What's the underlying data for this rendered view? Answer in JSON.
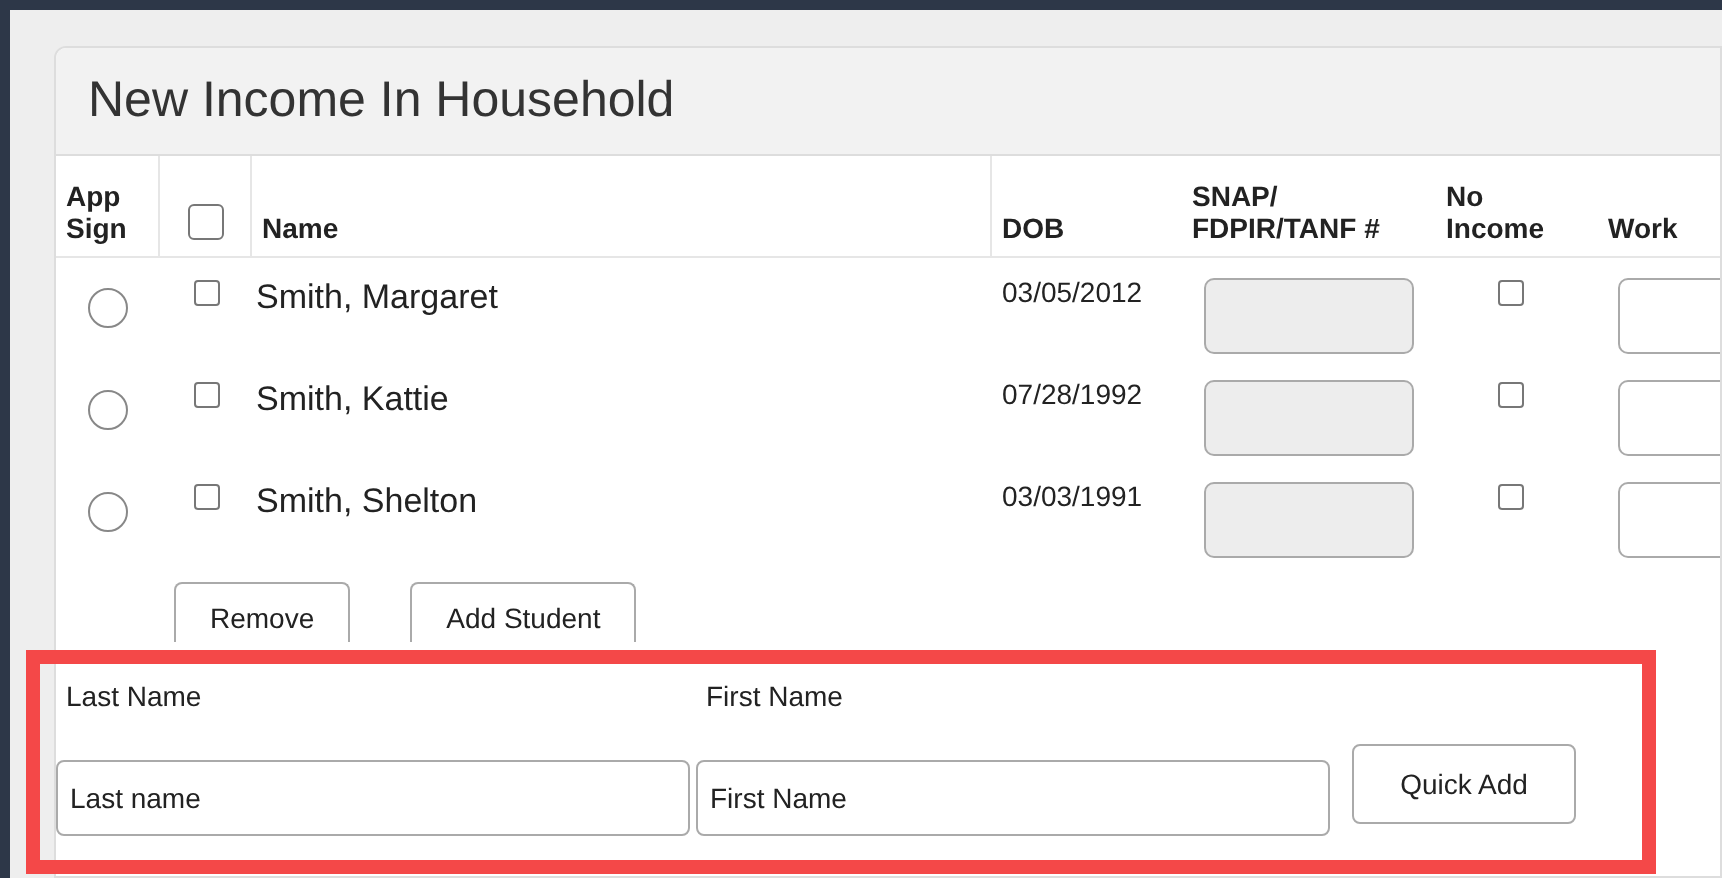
{
  "panel": {
    "title": "New Income In Household"
  },
  "table": {
    "columns": [
      "App Sign",
      "",
      "Name",
      "DOB",
      "SNAP/ FDPIR/TANF #",
      "No Income",
      "Work"
    ],
    "header_checkbox": {
      "checked": false
    },
    "rows": [
      {
        "app_sign": {
          "selected": false
        },
        "checked": false,
        "name": "Smith, Margaret",
        "dob": "03/05/2012",
        "snap_field": {
          "disabled": true
        },
        "no_income": {
          "checked": false
        }
      },
      {
        "app_sign": {
          "selected": false
        },
        "checked": false,
        "name": "Smith, Kattie",
        "dob": "07/28/1992",
        "snap_field": {
          "disabled": true
        },
        "no_income": {
          "checked": false
        }
      },
      {
        "app_sign": {
          "selected": false
        },
        "checked": false,
        "name": "Smith, Shelton",
        "dob": "03/03/1991",
        "snap_field": {
          "disabled": true
        },
        "no_income": {
          "checked": false
        }
      }
    ]
  },
  "buttons": [
    "Remove",
    "Add Student"
  ],
  "quick_add": {
    "last_name": {
      "label": "Last Name",
      "value": "Last name"
    },
    "first_name": {
      "label": "First Name",
      "value": "First Name"
    },
    "button": "Quick Add"
  }
}
